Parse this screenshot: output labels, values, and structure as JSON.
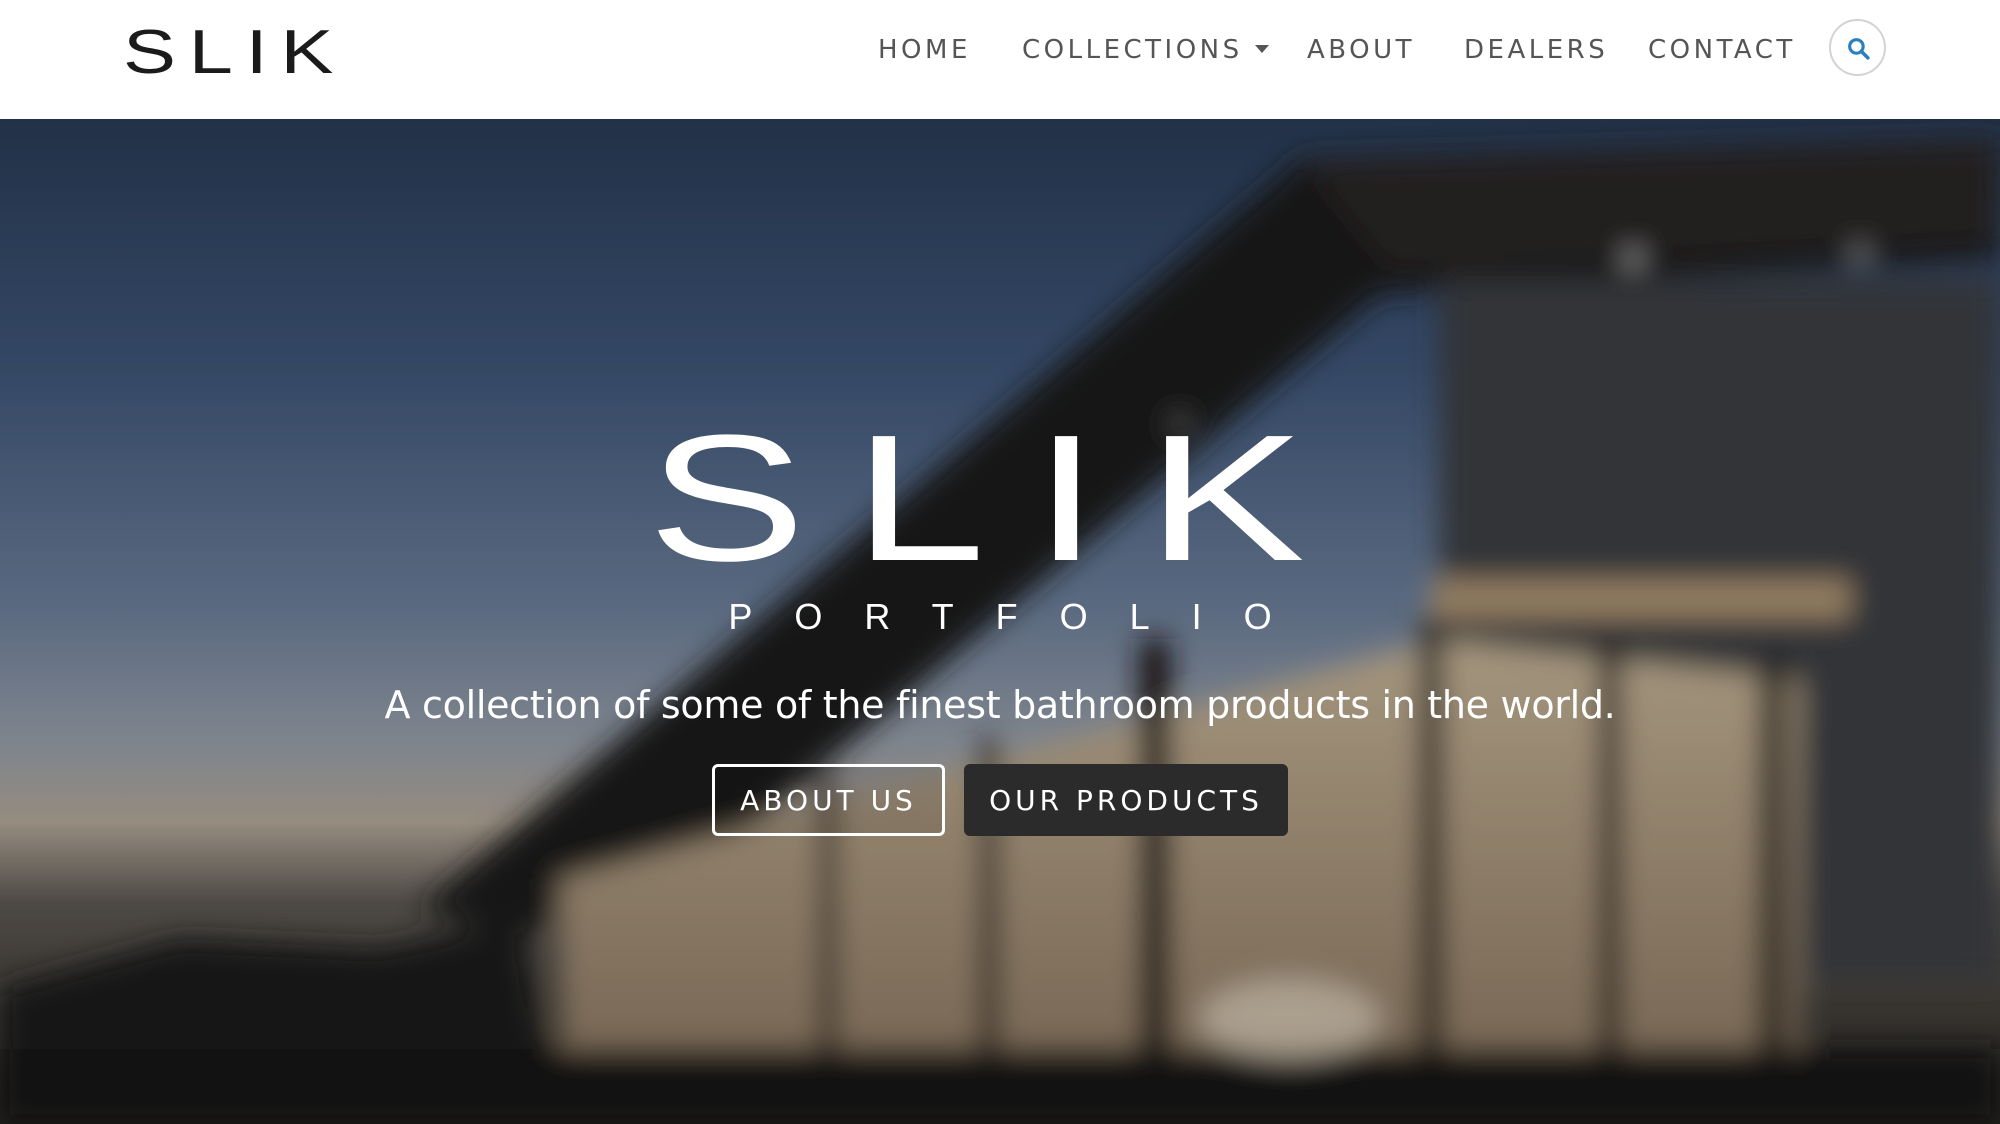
{
  "header": {
    "logo_text": "SLIK",
    "nav": [
      {
        "label": "HOME"
      },
      {
        "label": "COLLECTIONS",
        "has_dropdown": true
      },
      {
        "label": "ABOUT"
      },
      {
        "label": "DEALERS"
      },
      {
        "label": "CONTACT"
      }
    ],
    "search_icon": "search-icon"
  },
  "hero": {
    "wordmark": "SLIK",
    "subtitle": "PORTFOLIO",
    "tagline": "A collection of some of the finest bathroom products in the world.",
    "buttons": {
      "about_label": "ABOUT US",
      "products_label": "OUR PRODUCTS"
    }
  },
  "colors": {
    "accent": "#2a7fbd",
    "nav_text": "#555555",
    "button_dark": "#2b2b2b"
  }
}
